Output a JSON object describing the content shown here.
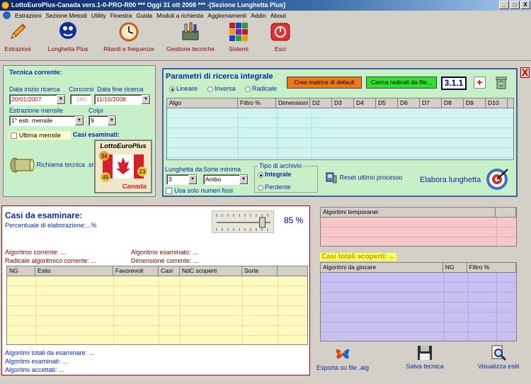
{
  "window": {
    "title": "LottoEuroPlus-Canada vers.1-0-PRO-R00  ***  Oggi 31 ott 2008  ***  -[Sezione Lunghetta Plus]",
    "buttons": [
      "_",
      "□",
      "X"
    ]
  },
  "menu": [
    "Estrazioni",
    "Sezione Metodi",
    "Utility",
    "Finestra",
    "Guida",
    "Moduli a richiesta",
    "Aggiornamenti",
    "Addin",
    "About"
  ],
  "toolbar": [
    {
      "label": "Estrazioni",
      "icon": "pencil-icon"
    },
    {
      "label": "Lunghetta Plus",
      "icon": "lottery-logo-icon"
    },
    {
      "label": "Ritardi e frequenze",
      "icon": "clock-icon"
    },
    {
      "label": "Gestione tecniche",
      "icon": "tools-icon"
    },
    {
      "label": "Sistemi",
      "icon": "grid-icon"
    },
    {
      "label": "Esci",
      "icon": "exit-icon"
    }
  ],
  "close_panel": "X",
  "tecnica": {
    "title": "Tecnica corrente:",
    "data_inizio_label": "Data inizio ricerca",
    "data_inizio": "20/01/2007",
    "concorsi_label": "Concorsi",
    "concorsi": "180",
    "data_fine_label": "Data fine ricerca",
    "data_fine": "11/10/2008",
    "estrazione_label": "Estrazione mensile",
    "estrazione": "1° estr. mensile",
    "colpi_label": "Colpi",
    "colpi": "9",
    "ultima_mensile": "Ultima mensile",
    "casi_esaminati": "Casi esaminati:",
    "richiama": "Richiama tecnica .sml",
    "logo_title": "LottoEuroPlus",
    "logo_sub": "Canada",
    "logo_balls": [
      "34",
      "49",
      "23"
    ]
  },
  "parametri": {
    "title": "Parametri di ricerca integrale",
    "radio": [
      "Lineare",
      "Inversa",
      "Radicale"
    ],
    "radio_selected": 0,
    "crea_matrice": "Crea matrice di default",
    "carica_radicali": "Carica radicali da file...",
    "version": "3.1.1",
    "plus": "+",
    "columns": [
      "Algo",
      "Filtro %",
      "Dimensioni",
      "D2",
      "D3",
      "D4",
      "D5",
      "D6",
      "D7",
      "D8",
      "D9",
      "D10"
    ],
    "lunghetta_label": "Lunghetta da",
    "lunghetta": "3",
    "sorte_label": "Sorte minima",
    "sorte": "Ambo",
    "usa_fissi": "Usa solo numeri fissi",
    "tipo_archivio": "Tipo di archivio",
    "archivio": [
      "Integrale",
      "Perdente"
    ],
    "archivio_selected": 0,
    "reset": "Reset ultimo processo",
    "elabora": "Elabora lunghetta"
  },
  "casi": {
    "title": "Casi da esaminare:",
    "percentuale_label": "Percentuale di elaborazione:",
    "percentuale_value": "...%",
    "slider_value": "85 %",
    "slider_level": 0.85,
    "algoritmo_corrente": "Algoritmo corrente: ...",
    "radicale": "Radicale algoritmico corrente: ...",
    "algoritmo_esaminato": "Algoritmo esaminato: ...",
    "dimensione": "Dimensione corrente: ...",
    "columns": [
      "NG",
      "Esito",
      "Favorevoli",
      "Casi",
      "NdC scoperti",
      "Sorte"
    ],
    "totali": "Algoritmi totali da esaminare: ...",
    "esaminati": "Algoritmi esaminati: ...",
    "accettati": "Algoritmi accettati: ..."
  },
  "temporanei": {
    "columns": [
      "Algoritmi temporanei"
    ]
  },
  "scoperti": {
    "title": "Casi totali scoperti: ...",
    "columns": [
      "Algoritmi da giocare",
      "NG",
      "Filtro %"
    ]
  },
  "bottom_buttons": [
    {
      "label": "Esporta su file .alg",
      "icon": "butterfly-icon"
    },
    {
      "label": "Salva tecnica",
      "icon": "floppy-icon"
    },
    {
      "label": "Visualizza esiti",
      "icon": "magnifier-icon"
    }
  ]
}
